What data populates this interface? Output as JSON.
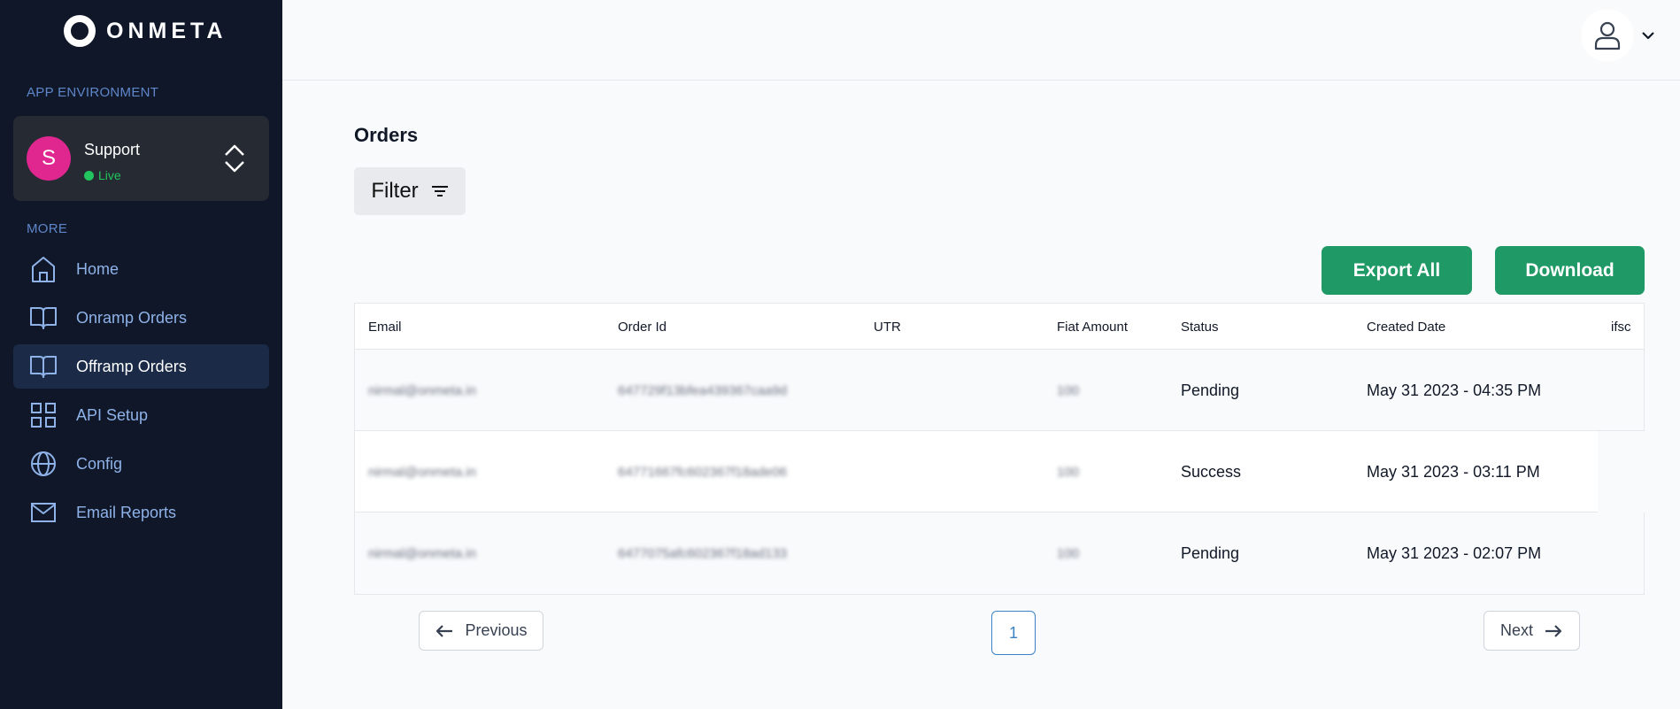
{
  "brand": {
    "name": "ONMETA"
  },
  "sidebar": {
    "env_label": "APP ENVIRONMENT",
    "env": {
      "avatar_letter": "S",
      "name": "Support",
      "status": "Live"
    },
    "more_label": "MORE",
    "items": [
      {
        "label": "Home",
        "icon": "home-icon"
      },
      {
        "label": "Onramp Orders",
        "icon": "book-icon"
      },
      {
        "label": "Offramp Orders",
        "icon": "book-icon",
        "active": true
      },
      {
        "label": "API Setup",
        "icon": "grid-icon"
      },
      {
        "label": "Config",
        "icon": "globe-icon"
      },
      {
        "label": "Email Reports",
        "icon": "mail-icon"
      }
    ]
  },
  "main": {
    "title": "Orders",
    "filter_label": "Filter",
    "export_label": "Export All",
    "download_label": "Download",
    "table": {
      "columns": [
        "Email",
        "Order Id",
        "UTR",
        "Fiat Amount",
        "Status",
        "Created Date",
        "ifsc"
      ],
      "rows": [
        {
          "email": "nirmal@onmeta.in",
          "order_id": "647729f13bfea439367caa9d",
          "utr": "",
          "fiat": "100",
          "status": "Pending",
          "date": "May 31 2023 - 04:35 PM"
        },
        {
          "email": "nirmal@onmeta.in",
          "order_id": "64771667fc602367f18ade06",
          "utr": "",
          "fiat": "100",
          "status": "Success",
          "date": "May 31 2023 - 03:11 PM"
        },
        {
          "email": "nirmal@onmeta.in",
          "order_id": "6477075afc602367f18ad133",
          "utr": "",
          "fiat": "100",
          "status": "Pending",
          "date": "May 31 2023 - 02:07 PM"
        }
      ]
    },
    "pagination": {
      "previous": "Previous",
      "next": "Next",
      "current_page": "1"
    }
  },
  "colors": {
    "sidebar_bg": "#0f1729",
    "accent_green": "#1f9965",
    "live_green": "#22c55e",
    "avatar_pink": "#e0268f",
    "page_blue": "#3b82c4"
  }
}
